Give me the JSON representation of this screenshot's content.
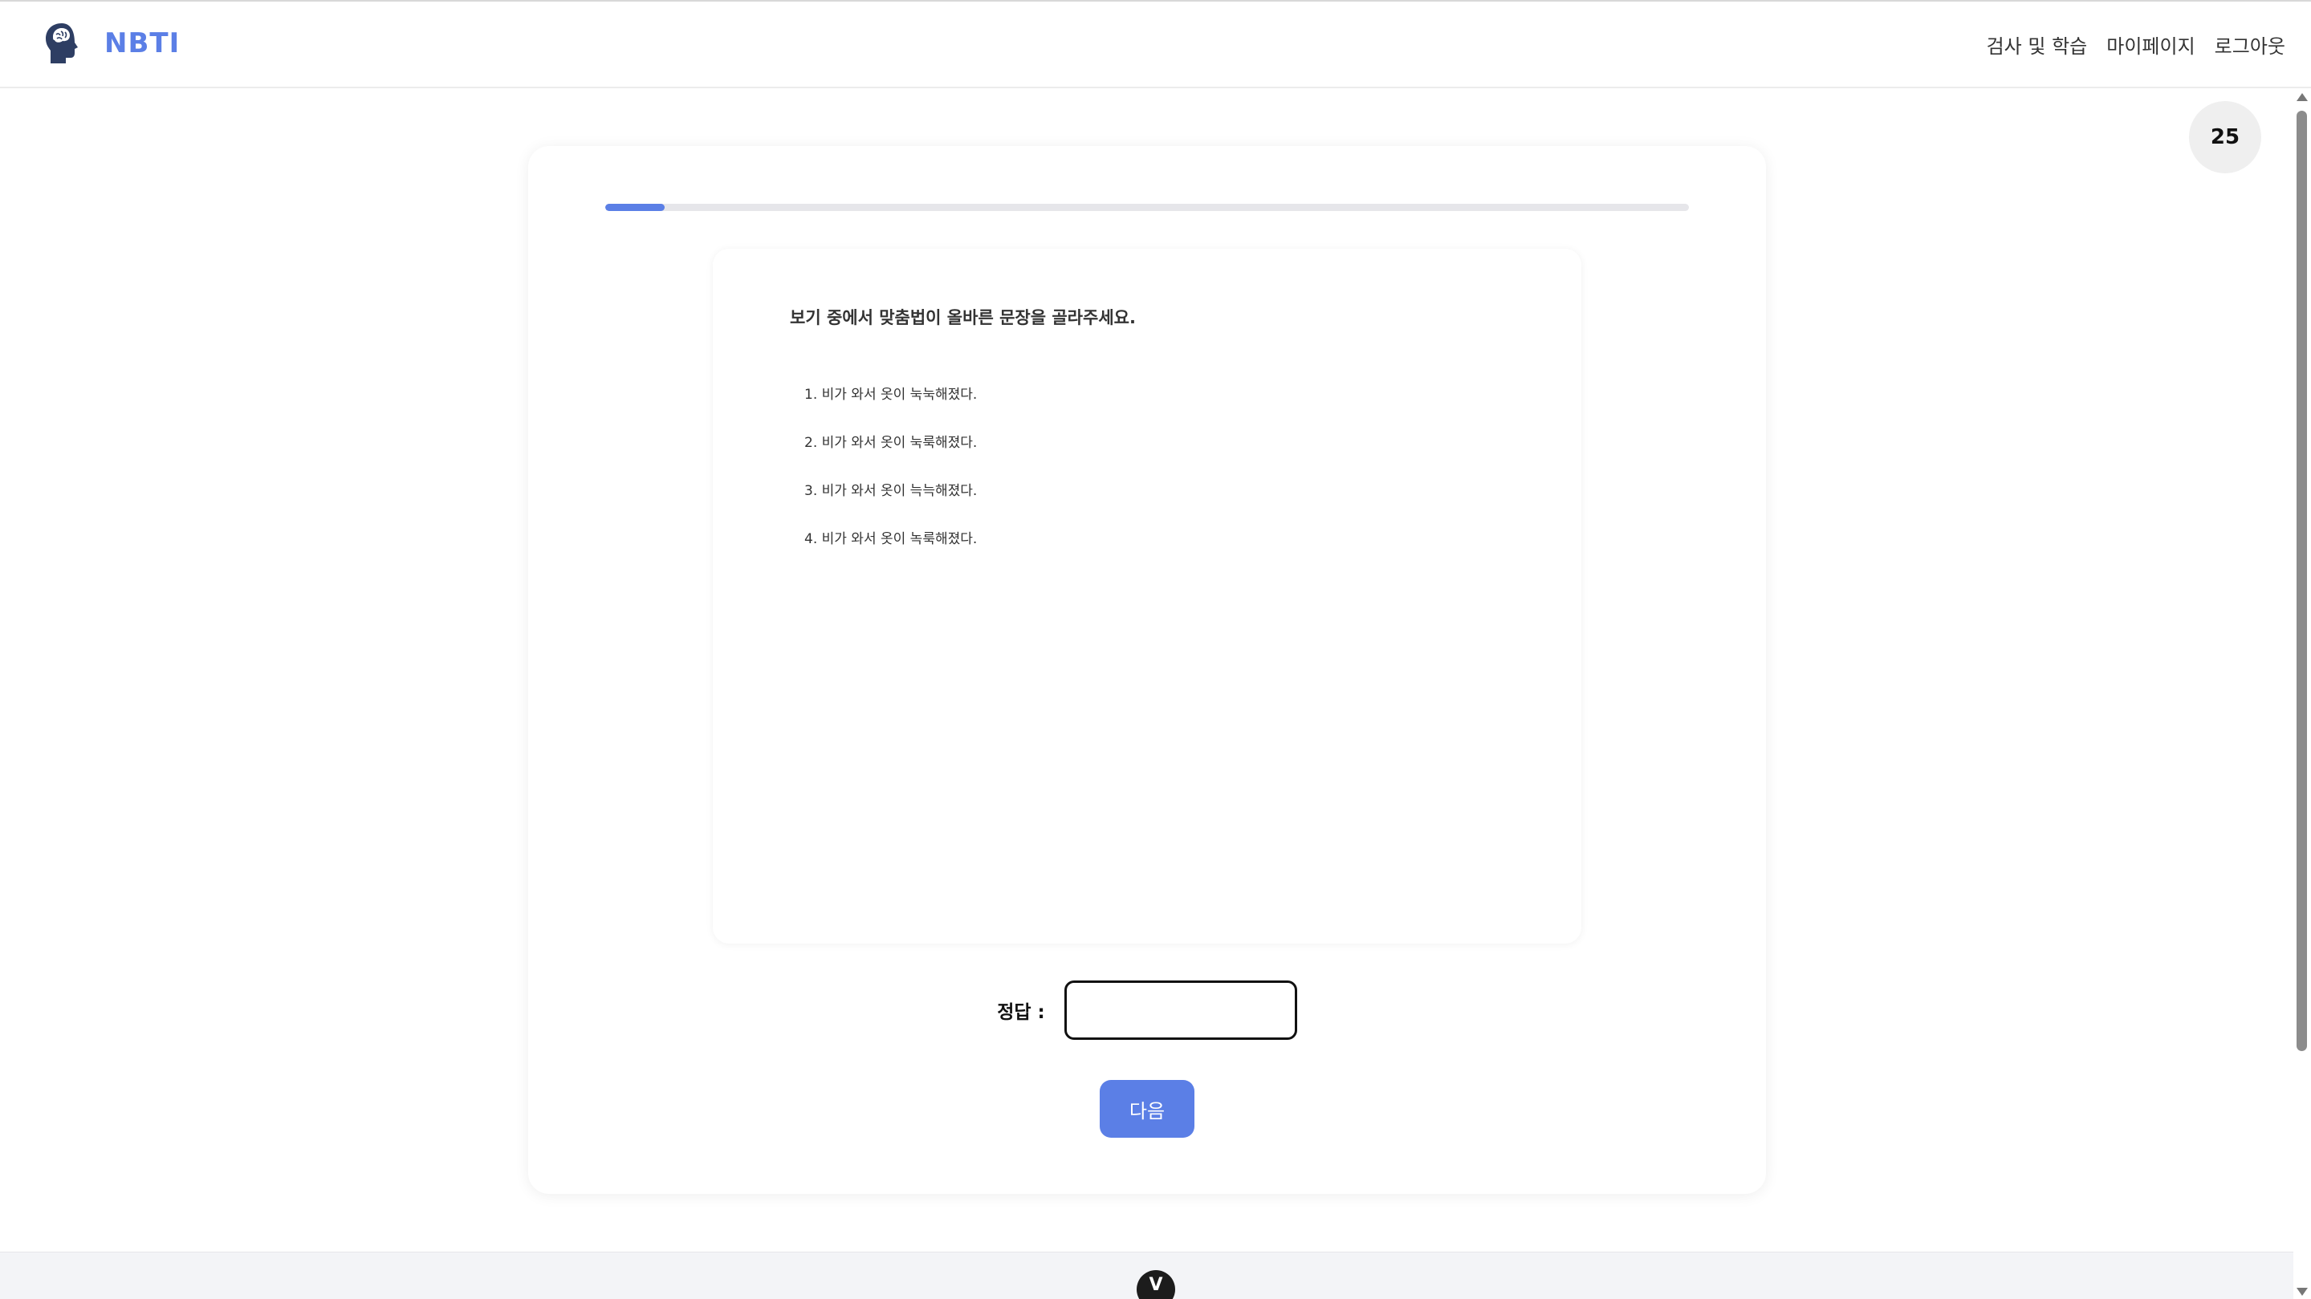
{
  "header": {
    "brand_name": "NBTI",
    "nav": {
      "test_and_study": "검사 및 학습",
      "my_page": "마이페이지",
      "logout": "로그아웃"
    }
  },
  "timer": {
    "value": "25"
  },
  "quiz": {
    "progress_fraction": 0.055,
    "question": "보기 중에서 맞춤법이 올바른 문장을 골라주세요.",
    "options": [
      "1. 비가 와서 옷이 눅눅해졌다.",
      "2. 비가 와서 옷이 눅룩해졌다.",
      "3. 비가 와서 옷이 늑늑해졌다.",
      "4. 비가 와서 옷이 녹룩해졌다."
    ],
    "answer_label": "정답 :",
    "answer_value": "",
    "next_label": "다음"
  },
  "footer": {
    "badge_text": "V"
  },
  "colors": {
    "accent": "#5b7fe6",
    "progress_track": "#e6e6ea",
    "timer_bg": "#efefef",
    "footer_bg": "#f3f4f7"
  }
}
